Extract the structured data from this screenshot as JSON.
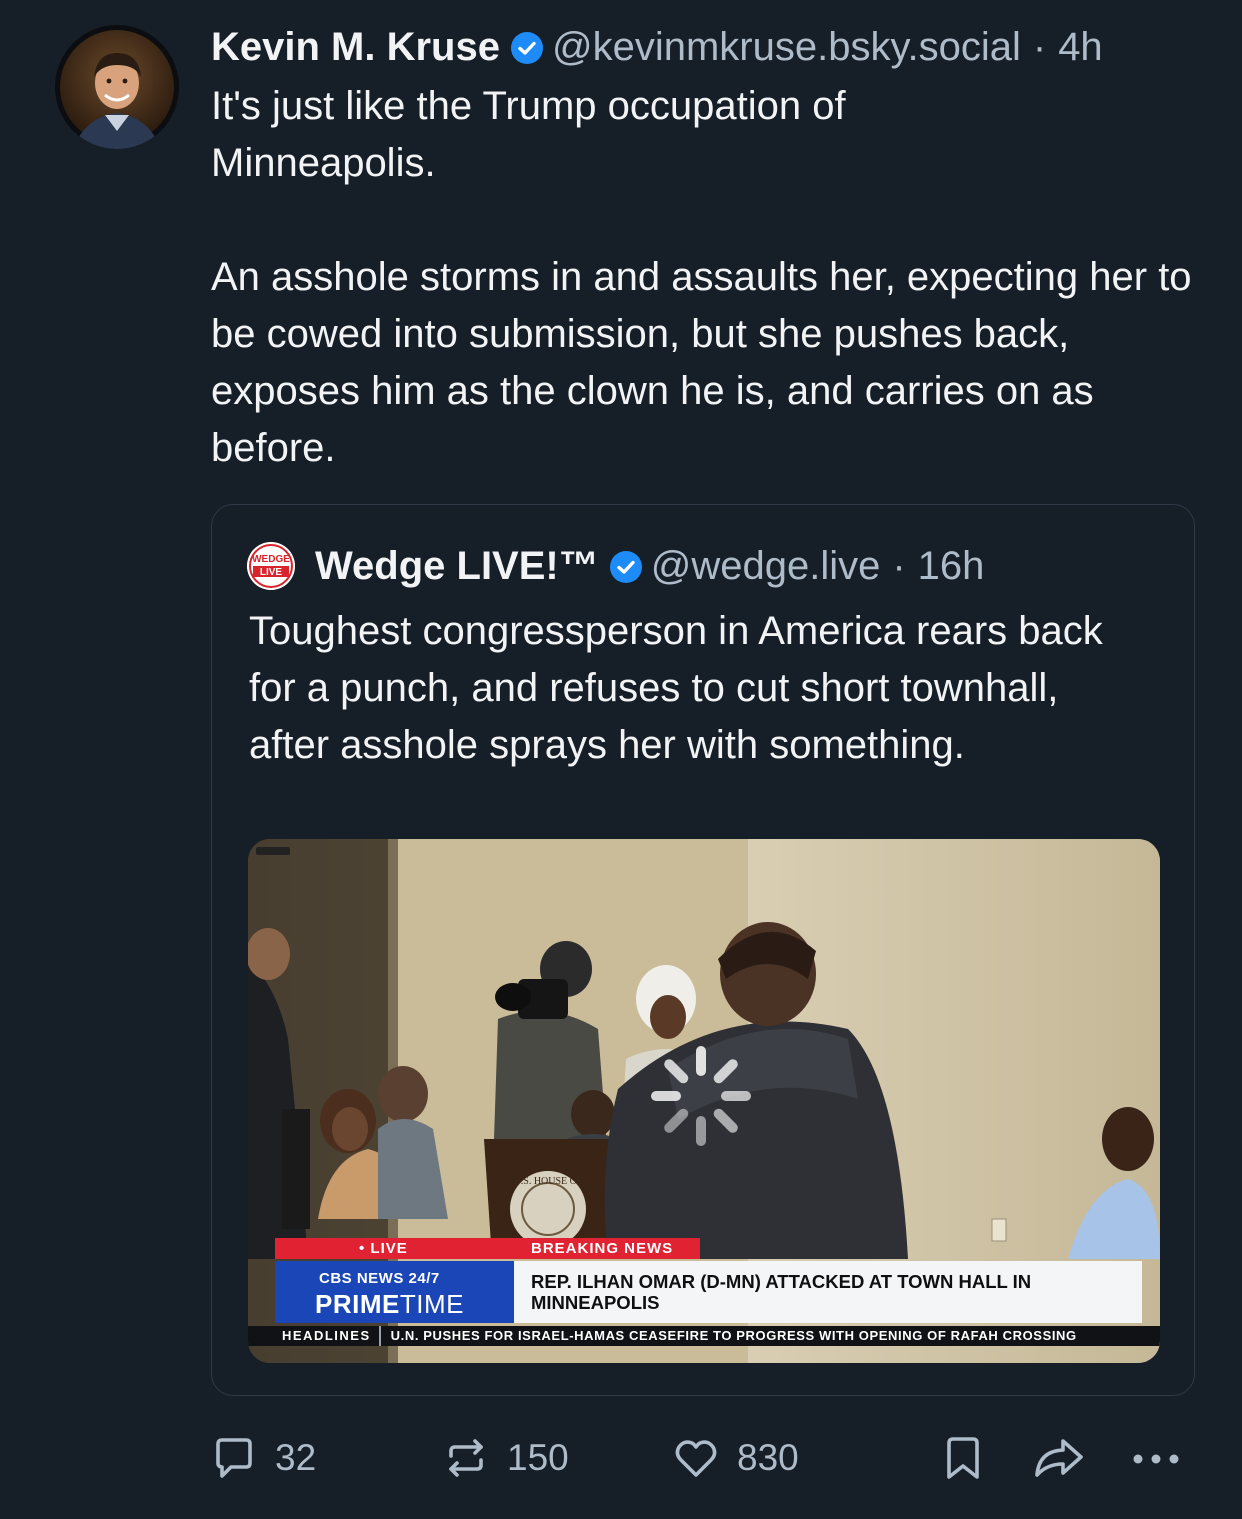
{
  "post": {
    "author_name": "Kevin M. Kruse",
    "handle": "@kevinmkruse.bsky.social",
    "separator": "·",
    "time": "4h",
    "text": "It's just like the Trump occupation of\nMinneapolis.\n\nAn asshole storms in and assaults her, expecting her to be cowed into submission, but she pushes back, exposes him as the clown he is, and carries on as before."
  },
  "quote": {
    "author_name": "Wedge LIVE!™",
    "handle": "@wedge.live",
    "separator": "·",
    "time": "16h",
    "avatar_text_top": "WEDGE",
    "avatar_text_bottom": "LIVE",
    "text": "Toughest congressperson in America rears back for a punch, and refuses to cut short townhall, after asshole sprays her with something.",
    "video": {
      "live_label": "• LIVE",
      "breaking_label": "BREAKING NEWS",
      "network": "CBS NEWS 24/7",
      "show_bold": "PRIME",
      "show_light": "TIME",
      "headline_line1": "REP. ILHAN OMAR (D-MN) ATTACKED AT TOWN HALL IN",
      "headline_line2": "MINNEAPOLIS",
      "ticker_label": "HEADLINES",
      "ticker_text": "U.N. PUSHES FOR ISRAEL-HAMAS CEASEFIRE TO PROGRESS WITH OPENING OF RAFAH CROSSING",
      "podium_seal_text": "U.S. HOUSE OF"
    }
  },
  "actions": {
    "reply_count": "32",
    "repost_count": "150",
    "like_count": "830",
    "icons": [
      "reply-icon",
      "repost-icon",
      "like-icon",
      "bookmark-icon",
      "share-icon",
      "more-icon"
    ]
  },
  "colors": {
    "background": "#161e27",
    "text_primary": "#f1f3f5",
    "text_secondary": "#aebbc9",
    "verified": "#1d8cf8",
    "border": "#2e3a48",
    "cbs_red": "#e02233",
    "cbs_blue": "#1a46b8"
  }
}
